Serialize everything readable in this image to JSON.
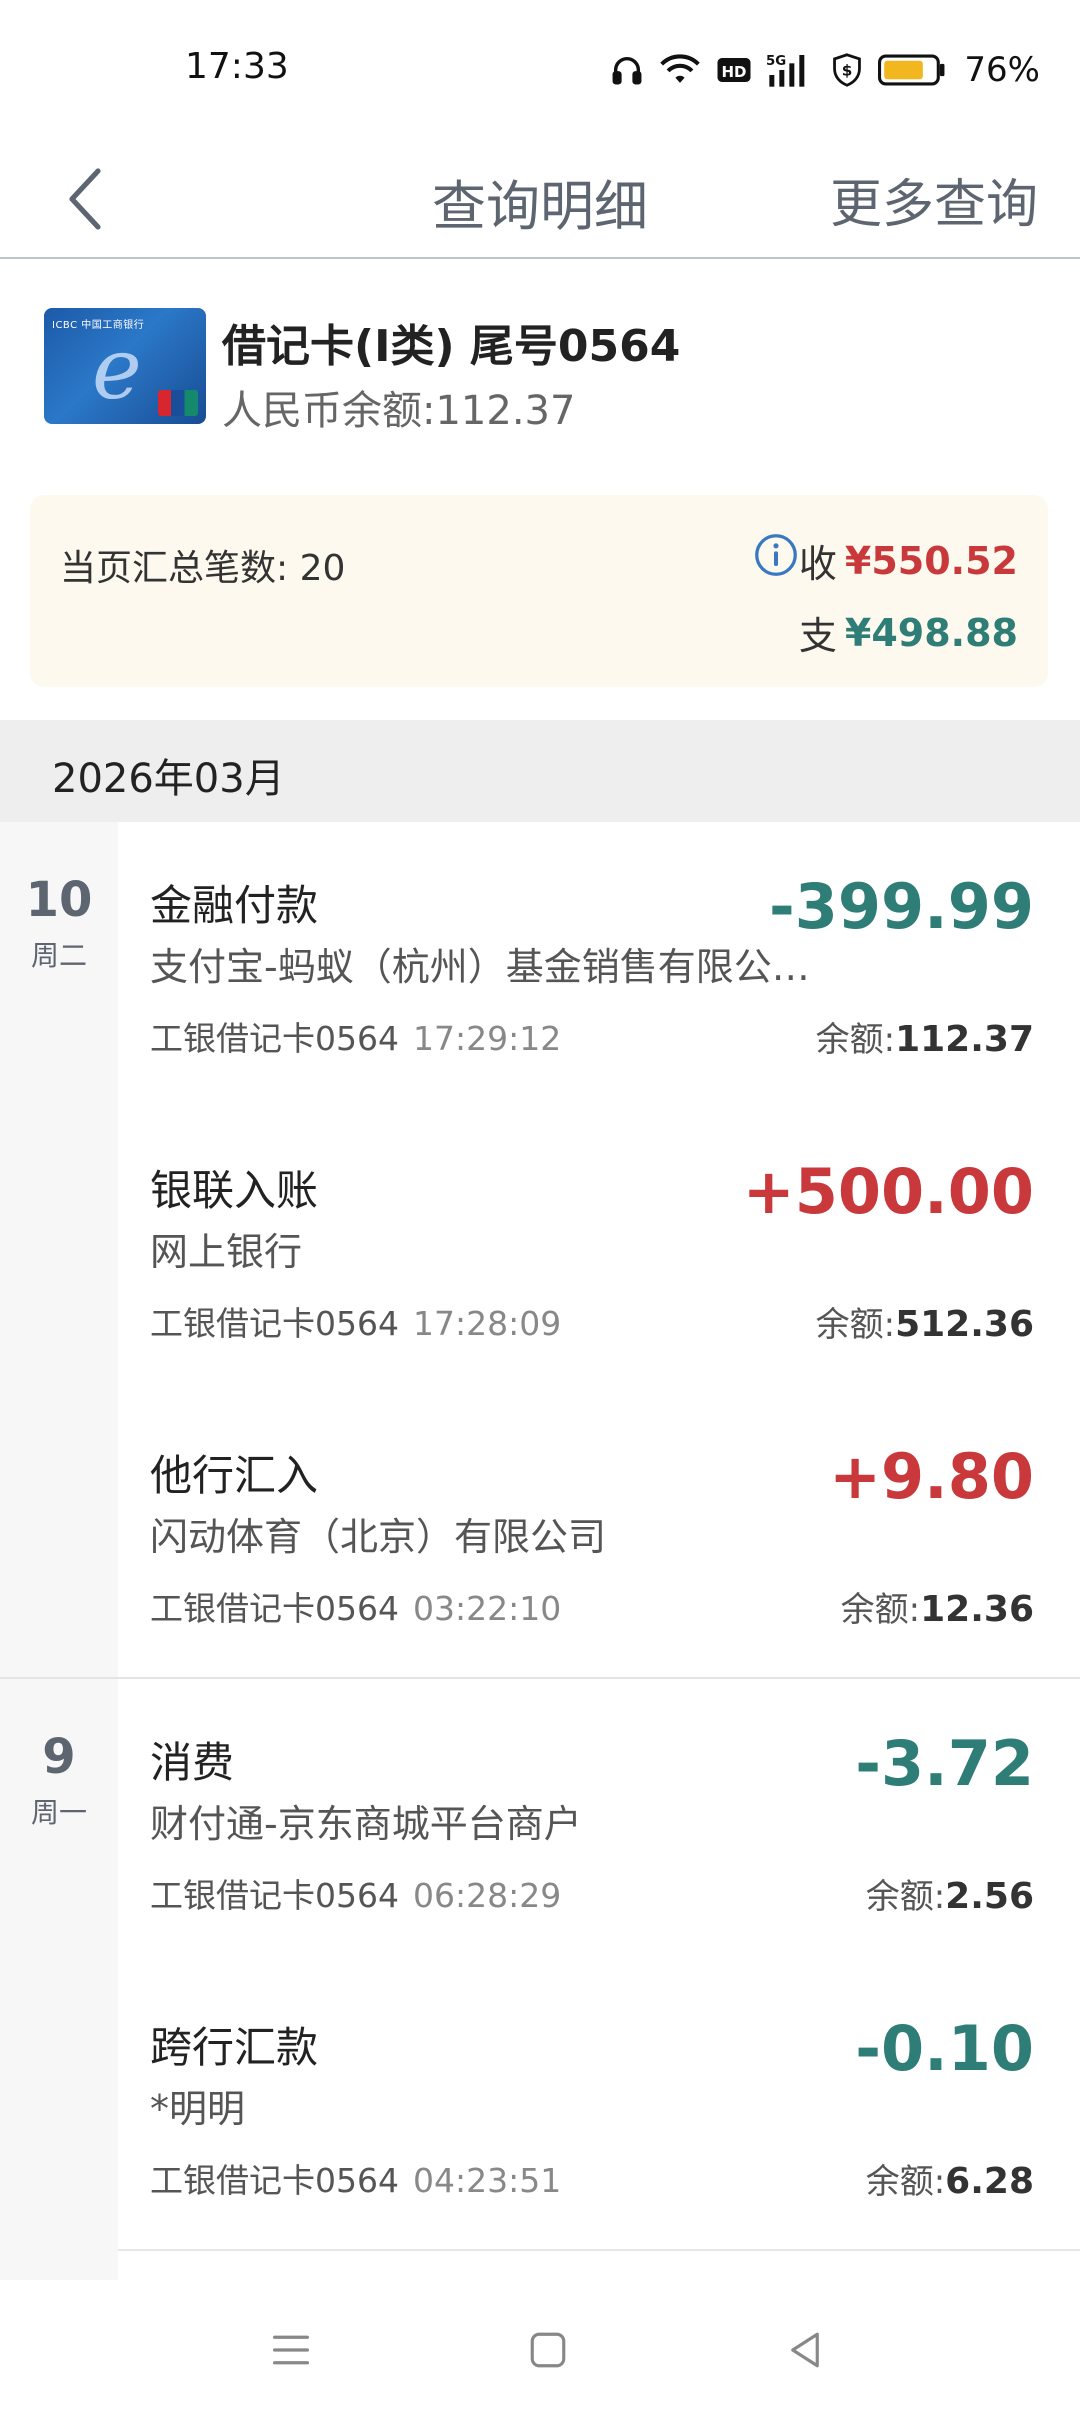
{
  "status_bar": {
    "time": "17:33",
    "icons": [
      "headphones-icon",
      "wifi-icon",
      "hd-icon",
      "5g-signal-icon",
      "shield-dollar-icon",
      "battery-icon"
    ],
    "battery_percent": "76%",
    "battery_color": "#f2b61e"
  },
  "header": {
    "back_icon": "chevron-left-icon",
    "title": "查询明细",
    "more_label": "更多查询"
  },
  "card": {
    "name": "借记卡(I类) 尾号0564",
    "balance": "人民币余额:112.37",
    "bank_text": "ICBC 中国工商银行"
  },
  "summary": {
    "count_label": "当页汇总笔数: 20",
    "income_label": "收",
    "income_amount": "¥550.52",
    "expense_label": "支",
    "expense_amount": "¥498.88"
  },
  "month": "2026年03月",
  "days": [
    {
      "day": "10",
      "weekday": "周二",
      "transactions": [
        {
          "type": "金融付款",
          "desc": "支付宝-蚂蚁（杭州）基金销售有限公…",
          "card": "工银借记卡0564",
          "time": "17:29:12",
          "amount": "-399.99",
          "direction": "neg",
          "balance_label": "余额:",
          "balance": "112.37"
        },
        {
          "type": "银联入账",
          "desc": "网上银行",
          "card": "工银借记卡0564",
          "time": "17:28:09",
          "amount": "+500.00",
          "direction": "pos",
          "balance_label": "余额:",
          "balance": "512.36"
        },
        {
          "type": "他行汇入",
          "desc": "闪动体育（北京）有限公司",
          "card": "工银借记卡0564",
          "time": "03:22:10",
          "amount": "+9.80",
          "direction": "pos",
          "balance_label": "余额:",
          "balance": "12.36"
        }
      ]
    },
    {
      "day": "9",
      "weekday": "周一",
      "transactions": [
        {
          "type": "消费",
          "desc": "财付通-京东商城平台商户",
          "card": "工银借记卡0564",
          "time": "06:28:29",
          "amount": "-3.72",
          "direction": "neg",
          "balance_label": "余额:",
          "balance": "2.56"
        },
        {
          "type": "跨行汇款",
          "desc": "*明明",
          "card": "工银借记卡0564",
          "time": "04:23:51",
          "amount": "-0.10",
          "direction": "neg",
          "balance_label": "余额:",
          "balance": "6.28"
        }
      ]
    }
  ],
  "nav_bar": {
    "icons": [
      "menu-icon",
      "home-square-icon",
      "back-triangle-icon"
    ]
  },
  "colors": {
    "income": "#c9383a",
    "expense": "#2f7d77",
    "summary_bg": "#fdf9ee",
    "month_bg": "#eeeeee"
  }
}
